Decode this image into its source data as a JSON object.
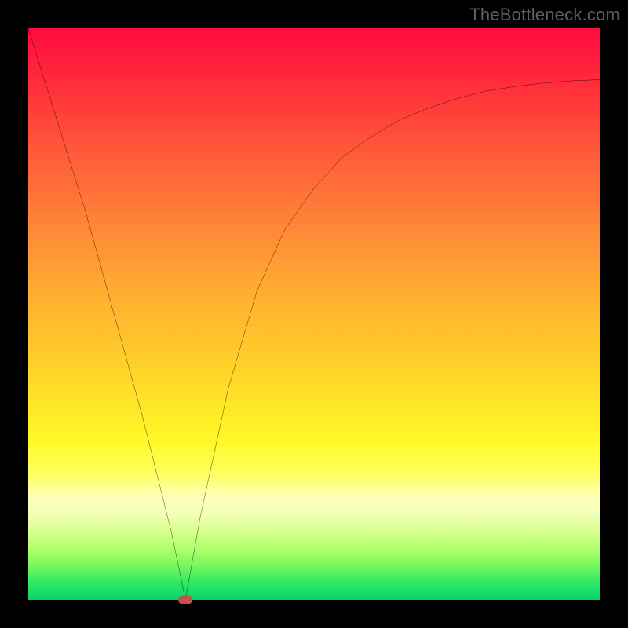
{
  "attribution": "TheBottleneck.com",
  "chart_data": {
    "type": "line",
    "title": "",
    "xlabel": "",
    "ylabel": "",
    "xlim": [
      0,
      100
    ],
    "ylim": [
      0,
      100
    ],
    "background_gradient": {
      "top": "#ff0a3e",
      "bottom": "#08d46b"
    },
    "series": [
      {
        "name": "curve",
        "x": [
          0,
          5,
          10,
          15,
          20,
          25,
          27.5,
          30,
          35,
          40,
          45,
          50,
          55,
          60,
          65,
          70,
          75,
          80,
          85,
          90,
          95,
          100
        ],
        "values": [
          100,
          84,
          68,
          50,
          32,
          12,
          0,
          14,
          37,
          54,
          65,
          72,
          77.5,
          81,
          84,
          86,
          87.7,
          89,
          89.8,
          90.4,
          90.8,
          91
        ]
      }
    ],
    "marker": {
      "x": 27.5,
      "y": 0,
      "color": "#c0544a"
    }
  }
}
